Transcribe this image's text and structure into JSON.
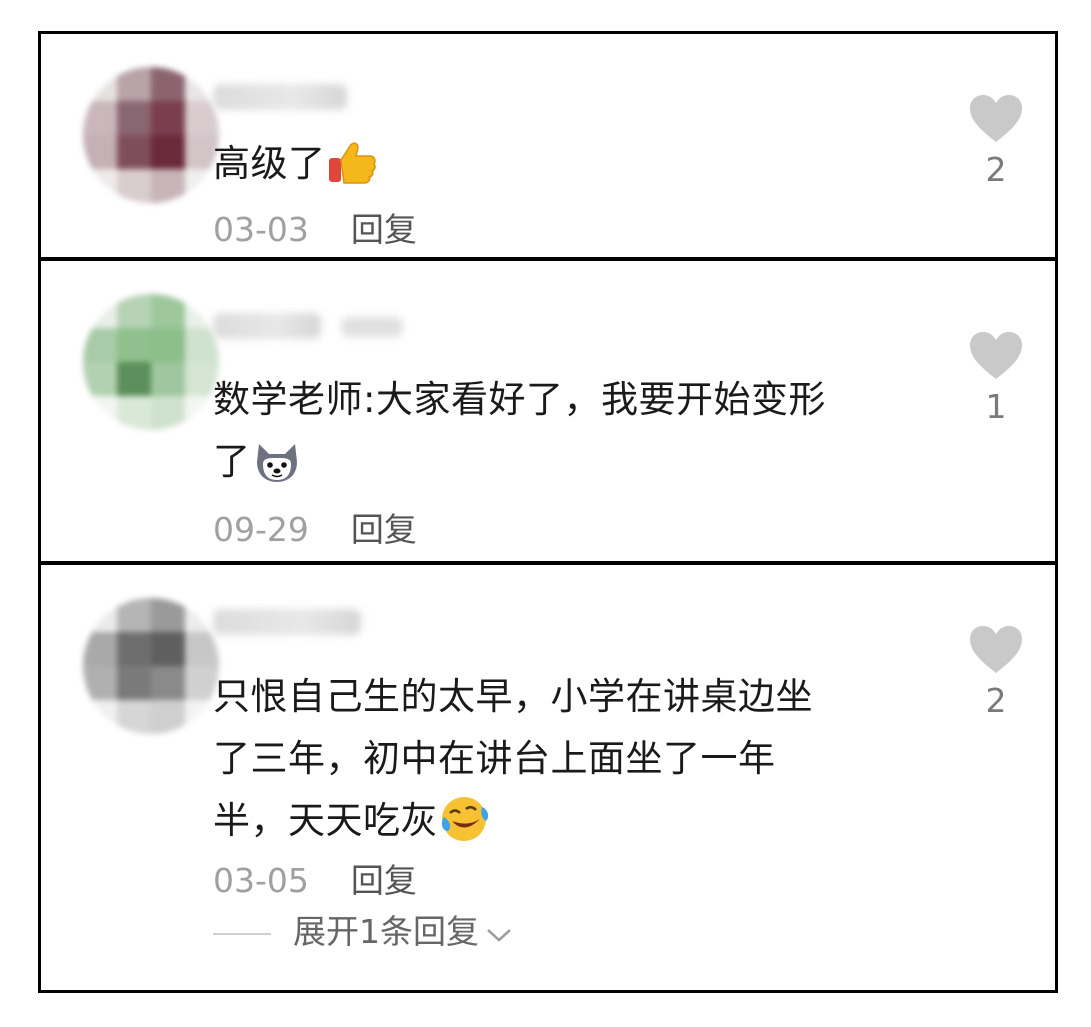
{
  "comments": [
    {
      "text": "高级了",
      "emoji": "thumbs-up-icon",
      "date": "03-03",
      "reply_label": "回复",
      "likes": "2"
    },
    {
      "text_line1": "数学老师:大家看好了，我要开始变形",
      "text_line2": "了",
      "emoji": "doge-dog-icon",
      "date": "09-29",
      "reply_label": "回复",
      "likes": "1"
    },
    {
      "text_line1": "只恨自己生的太早，小学在讲桌边坐",
      "text_line2": "了三年，初中在讲台上面坐了一年",
      "text_line3": "半，天天吃灰",
      "emoji": "laughing-crying-icon",
      "date": "03-05",
      "reply_label": "回复",
      "likes": "2",
      "expand_label": "展开1条回复"
    }
  ],
  "colors": {
    "heart": "#c9c9c9",
    "meta": "#a0a0a0",
    "text": "#1a1a1a"
  }
}
